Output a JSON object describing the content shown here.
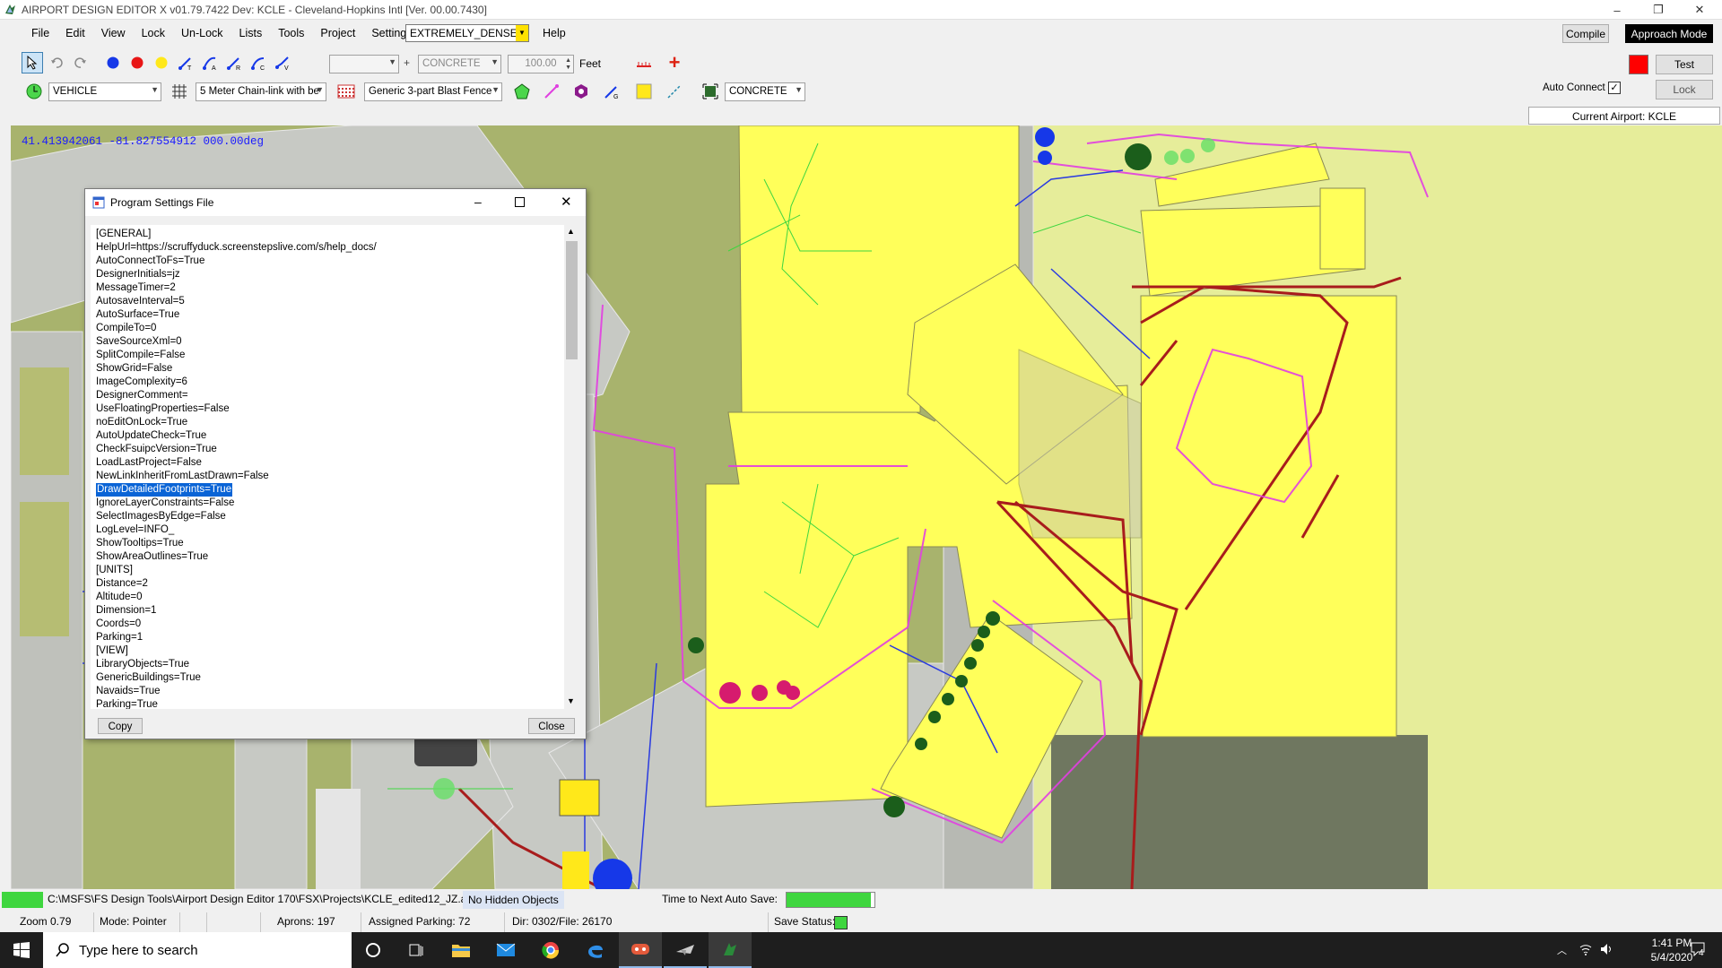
{
  "window": {
    "title": "AIRPORT DESIGN EDITOR X  v01.79.7422 Dev: KCLE - Cleveland-Hopkins Intl [Ver. 00.00.7430]",
    "minimize_glyph": "–",
    "restore_glyph": "❐",
    "close_glyph": "✕"
  },
  "menubar": {
    "items": [
      "File",
      "Edit",
      "View",
      "Lock",
      "Un-Lock",
      "Lists",
      "Tools",
      "Project",
      "Settings"
    ],
    "density_value": "EXTREMELY_DENSE",
    "help": "Help"
  },
  "top_right": {
    "compile": "Compile",
    "approach_mode": "Approach Mode",
    "test": "Test",
    "auto_connect": "Auto Connect",
    "lock": "Lock",
    "current_airport": "Current Airport: KCLE",
    "red_swatch_color": "#ff0000"
  },
  "toolbar1": {
    "surface_value": "CONCRETE",
    "width_value": "100.00",
    "units": "Feet",
    "plus": "+",
    "tools": [
      "pointer-icon",
      "undo-icon",
      "redo-icon",
      "blue-node-icon",
      "red-node-icon",
      "yellow-node-icon",
      "taxi-link-icon",
      "apron-link-icon",
      "runway-link-icon",
      "closed-link-icon",
      "vehicle-link-icon"
    ]
  },
  "toolbar2": {
    "vehicle_value": "VEHICLE",
    "fence_value": "5 Meter Chain-link with be",
    "blast_fence_value": "Generic 3-part Blast Fence",
    "surface2_value": "CONCRETE"
  },
  "map": {
    "coords": "41.413942061  -81.827554912 000.00deg"
  },
  "dialog": {
    "title": "Program Settings File",
    "lines": [
      "[GENERAL]",
      "HelpUrl=https://scruffyduck.screenstepslive.com/s/help_docs/",
      "AutoConnectToFs=True",
      "DesignerInitials=jz",
      "MessageTimer=2",
      "AutosaveInterval=5",
      "AutoSurface=True",
      "CompileTo=0",
      "SaveSourceXml=0",
      "SplitCompile=False",
      "ShowGrid=False",
      "ImageComplexity=6",
      "DesignerComment=",
      "UseFloatingProperties=False",
      "noEditOnLock=True",
      "AutoUpdateCheck=True",
      "CheckFsuipcVersion=True",
      "LoadLastProject=False",
      "NewLinkInheritFromLastDrawn=False",
      "DrawDetailedFootprints=True",
      "IgnoreLayerConstraints=False",
      "SelectImagesByEdge=False",
      "LogLevel=INFO_",
      "ShowTooltips=True",
      "ShowAreaOutlines=True",
      "[UNITS]",
      "Distance=2",
      "Altitude=0",
      "Dimension=1",
      "Coords=0",
      "Parking=1",
      "[VIEW]",
      "LibraryObjects=True",
      "GenericBuildings=True",
      "Navaids=True",
      "Parking=True"
    ],
    "selected_index": 19,
    "copy": "Copy",
    "close": "Close"
  },
  "status": {
    "path": "C:\\MSFS\\FS Design Tools\\Airport Design Editor 170\\FSX\\Projects\\KCLE_edited12_JZ.ad4",
    "hidden": "No Hidden Objects",
    "autosave_label": "Time to Next Auto Save:",
    "zoom": "Zoom 0.79",
    "mode": "Mode: Pointer",
    "aprons": "Aprons: 197",
    "assigned_parking": "Assigned Parking: 72",
    "dir": "Dir: 0302/File: 26170",
    "save_status": "Save Status:",
    "green": "#3fd63f"
  },
  "taskbar": {
    "search_placeholder": "Type here to search",
    "time": "1:41 PM",
    "date": "5/4/2020",
    "notif_count": "4"
  }
}
